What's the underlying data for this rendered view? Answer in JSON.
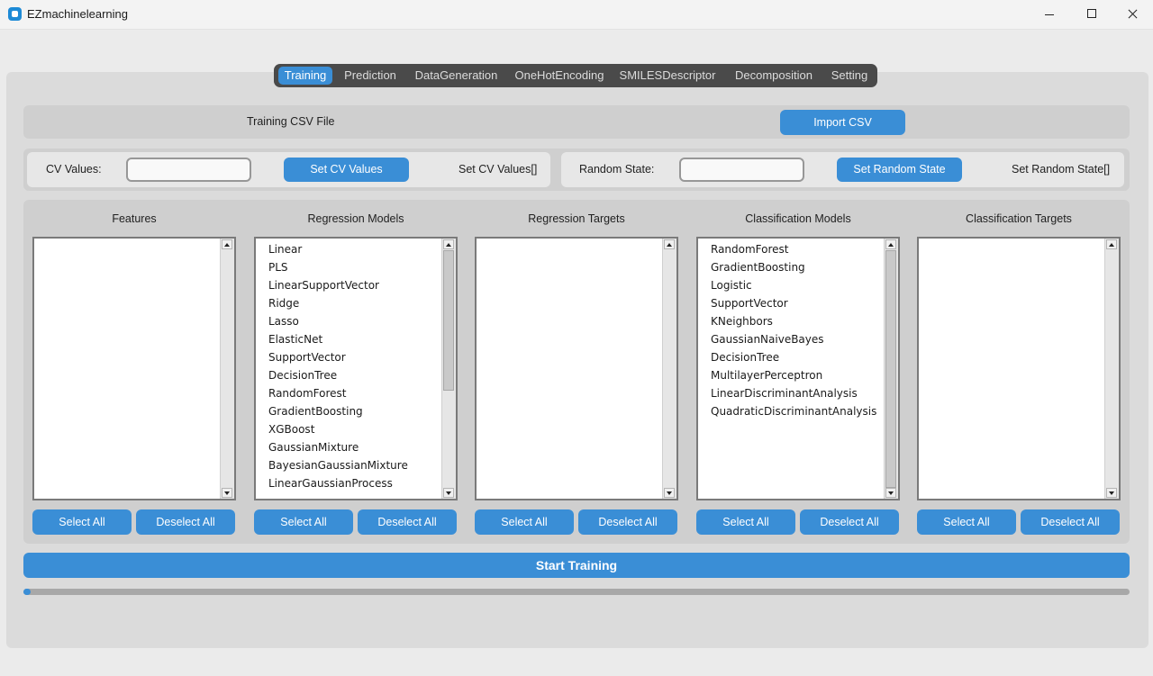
{
  "window": {
    "title": "EZmachinelearning"
  },
  "tabs": [
    "Training",
    "Prediction",
    "DataGeneration",
    "OneHotEncoding",
    "SMILESDescriptor",
    "Decomposition",
    "Setting"
  ],
  "csv_row": {
    "label": "Training CSV File",
    "button": "Import CSV"
  },
  "cv": {
    "label": "CV Values:",
    "value": "",
    "button": "Set CV Values",
    "status": "Set CV Values[]"
  },
  "random_state": {
    "label": "Random State:",
    "value": "",
    "button": "Set Random State",
    "status": "Set Random State[]"
  },
  "columns": [
    {
      "title": "Features",
      "items": [],
      "select_all": "Select All",
      "deselect_all": "Deselect All"
    },
    {
      "title": "Regression Models",
      "items": [
        "Linear",
        "PLS",
        "LinearSupportVector",
        "Ridge",
        "Lasso",
        "ElasticNet",
        "SupportVector",
        "DecisionTree",
        "RandomForest",
        "GradientBoosting",
        "XGBoost",
        "GaussianMixture",
        "BayesianGaussianMixture",
        "LinearGaussianProcess"
      ],
      "select_all": "Select All",
      "deselect_all": "Deselect All"
    },
    {
      "title": "Regression Targets",
      "items": [],
      "select_all": "Select All",
      "deselect_all": "Deselect All"
    },
    {
      "title": "Classification Models",
      "items": [
        "RandomForest",
        "GradientBoosting",
        "Logistic",
        "SupportVector",
        "KNeighbors",
        "GaussianNaiveBayes",
        "DecisionTree",
        "MultilayerPerceptron",
        "LinearDiscriminantAnalysis",
        "QuadraticDiscriminantAnalysis"
      ],
      "select_all": "Select All",
      "deselect_all": "Deselect All"
    },
    {
      "title": "Classification Targets",
      "items": [],
      "select_all": "Select All",
      "deselect_all": "Deselect All"
    }
  ],
  "start_button": "Start Training",
  "progress": 0.005,
  "colors": {
    "accent": "#3a8ed6",
    "tabbar": "#4a4a4a",
    "frame": "#dbdbdb"
  }
}
